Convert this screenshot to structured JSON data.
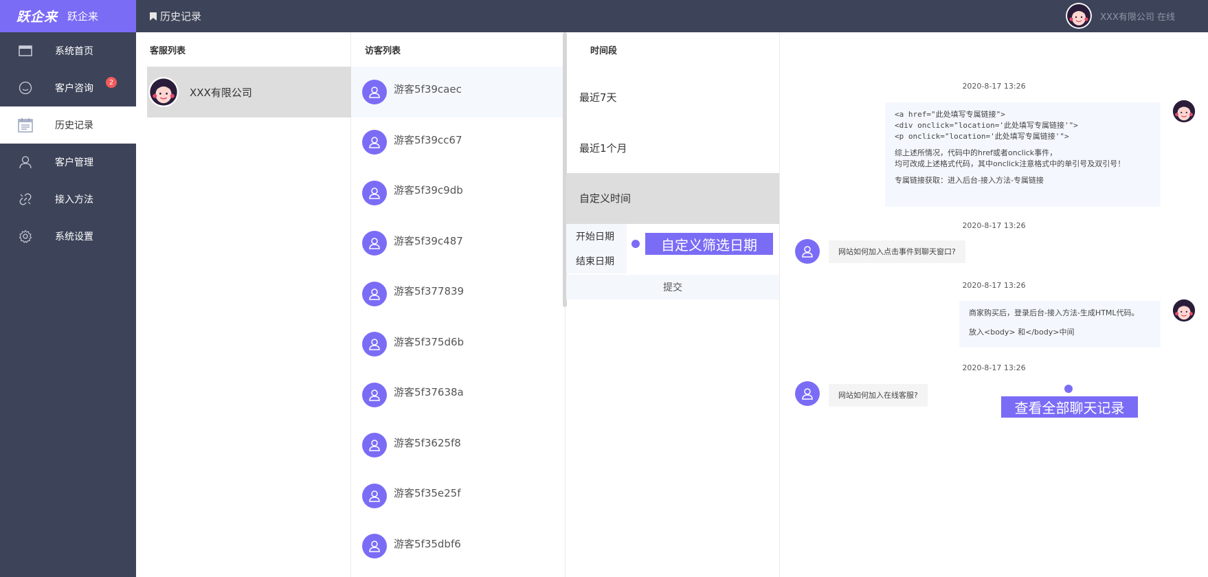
{
  "brand": {
    "logo": "跃企来",
    "name": "跃企来",
    "accent": "#7b6cf6"
  },
  "sidebar": {
    "items": [
      {
        "label": "系统首页",
        "icon": "window-icon"
      },
      {
        "label": "客户咨询",
        "icon": "smile-icon",
        "badge": "2"
      },
      {
        "label": "历史记录",
        "icon": "history-icon",
        "active": true
      },
      {
        "label": "客户管理",
        "icon": "user-icon"
      },
      {
        "label": "接入方法",
        "icon": "link-icon"
      },
      {
        "label": "系统设置",
        "icon": "gear-icon"
      }
    ]
  },
  "topbar": {
    "breadcrumb": "历史记录",
    "user": "XXX有限公司 在线"
  },
  "agents": {
    "title": "客服列表",
    "items": [
      {
        "name": "XXX有限公司"
      }
    ]
  },
  "visitors": {
    "title": "访客列表",
    "items": [
      "游客5f39caec",
      "游客5f39cc67",
      "游客5f39c9db",
      "游客5f39c487",
      "游客5f377839",
      "游客5f375d6b",
      "游客5f37638a",
      "游客5f3625f8",
      "游客5f35e25f",
      "游客5f35dbf6"
    ]
  },
  "timeframe": {
    "title": "时间段",
    "options": [
      "最近7天",
      "最近1个月",
      "自定义时间"
    ],
    "start_label": "开始日期",
    "end_label": "结束日期",
    "submit": "提交",
    "callout": "自定义筛选日期"
  },
  "chat": {
    "messages": [
      {
        "time": "2020-8-17 13:26",
        "side": "right",
        "lines": [
          "<a href=\"此处填写专属链接\">",
          "<div onclick=\"location='此处填写专属链接'\">",
          "<p onclick=\"location='此处填写专属链接'\">",
          "",
          "综上述所情况，代码中的href或者onclick事件，",
          "均可改成上述格式代码，其中onclick注意格式中的单引号及双引号！",
          "",
          "专属链接获取：进入后台-接入方法-专属链接"
        ]
      },
      {
        "time": "2020-8-17 13:26",
        "side": "left",
        "lines": [
          "网站如何加入点击事件到聊天窗口?"
        ]
      },
      {
        "time": "2020-8-17 13:26",
        "side": "right",
        "lines": [
          "商家购买后，登录后台-接入方法-生成HTML代码。",
          "",
          "放入<body> 和</body>中间"
        ]
      },
      {
        "time": "2020-8-17 13:26",
        "side": "left",
        "lines": [
          "网站如何加入在线客服?"
        ]
      }
    ],
    "callout": "查看全部聊天记录"
  }
}
